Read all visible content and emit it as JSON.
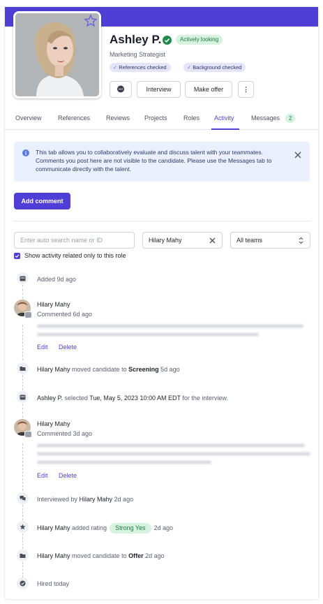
{
  "profile": {
    "name": "Ashley P.",
    "status_badge": "Actively looking",
    "role_title": "Marketing Strategist",
    "chips": [
      "References checked",
      "Background checked"
    ],
    "actions": {
      "interview": "Interview",
      "make_offer": "Make offer",
      "more": "⋮"
    }
  },
  "tabs": [
    {
      "label": "Overview"
    },
    {
      "label": "References"
    },
    {
      "label": "Reviews"
    },
    {
      "label": "Projects"
    },
    {
      "label": "Roles"
    },
    {
      "label": "Activity",
      "active": true
    },
    {
      "label": "Messages",
      "count": "2"
    }
  ],
  "info_banner": {
    "text": "This tab allows you to collaboratively evaluate and discuss talent with your teammates. Comments you post here are not visible to the candidate. Please use the Messages tab to communicate directly with the talent."
  },
  "add_comment_label": "Add comment",
  "filters": {
    "search_placeholder": "Enter auto search name or ID",
    "member_value": "Hilary Mahy",
    "team_value": "All teams",
    "checkbox_label": "Show activity related only to this role"
  },
  "events": {
    "added": "Added 9d ago",
    "c1": {
      "author": "Hilary Mahy",
      "time": "Commented 6d ago",
      "edit": "Edit",
      "delete": "Delete"
    },
    "screening": {
      "actor": "Hilary Mahy",
      "mid": " moved candidate to ",
      "stage": "Screening",
      "ago": " 5d ago"
    },
    "selected": {
      "actor": "Ashley P.",
      "mid": " selected ",
      "when": "Tue, May 5, 2023 10:00 AM EDT",
      "tail": " for the interview."
    },
    "c2": {
      "author": "Hilary Mahy",
      "time": "Commented 3d ago",
      "edit": "Edit",
      "delete": "Delete"
    },
    "interviewed": {
      "pre": "Interviewed by ",
      "actor": "Hilary Mahy",
      "ago": " 2d ago"
    },
    "rating": {
      "actor": "Hilary Mahy",
      "mid": " added rating",
      "value": "Strong Yes",
      "ago": "2d ago"
    },
    "offer": {
      "actor": "Hilary Mahy",
      "mid": " moved candidate to ",
      "stage": "Offer",
      "ago": " 2d ago"
    },
    "hired": "Hired today"
  },
  "colors": {
    "accent": "#4f3fd6",
    "success": "#1f8a4c",
    "info_bg": "#eaf0fd"
  }
}
